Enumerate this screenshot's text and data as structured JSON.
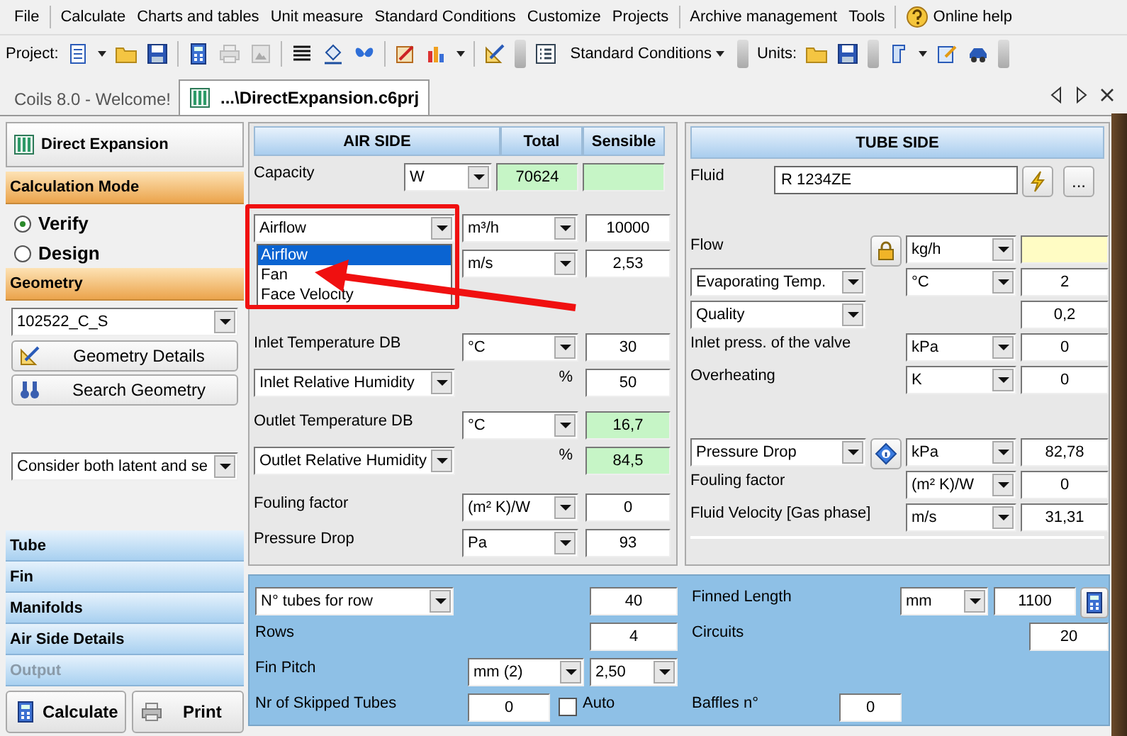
{
  "menu": [
    {
      "items": [
        {
          "label": "File",
          "kind": "text"
        }
      ]
    },
    {
      "items": [
        {
          "label": "Calculate",
          "kind": "text"
        },
        {
          "label": "Charts and tables",
          "kind": "text"
        },
        {
          "label": "Unit measure",
          "kind": "text"
        },
        {
          "label": "Standard Conditions",
          "kind": "text"
        },
        {
          "label": "Customize",
          "kind": "text"
        },
        {
          "label": "Projects",
          "kind": "text"
        }
      ]
    },
    {
      "items": [
        {
          "label": "Archive management",
          "kind": "text"
        },
        {
          "label": "Tools",
          "kind": "text"
        }
      ]
    },
    {
      "items": [
        {
          "label": "Online help",
          "kind": "help"
        }
      ]
    }
  ],
  "toolbar": {
    "project_label": "Project:",
    "conditions_button": "Standard Conditions",
    "units_label": "Units:"
  },
  "tabs": [
    {
      "label": "Coils 8.0 - Welcome!",
      "selected": false
    },
    {
      "label": "...\\DirectExpansion.c6prj",
      "selected": true
    }
  ],
  "sidebar": {
    "title": "Direct Expansion",
    "calculation_mode": {
      "title": "Calculation Mode",
      "options": [
        {
          "label": "Verify",
          "selected": true
        },
        {
          "label": "Design",
          "selected": false
        }
      ]
    },
    "geometry": {
      "title": "Geometry",
      "selected_geometry": "102522_C_S",
      "buttons": [
        "Geometry Details",
        "Search Geometry"
      ],
      "humidity_mode": "Consider both latent and se"
    },
    "nav_items": [
      {
        "label": "Tube",
        "disabled": false
      },
      {
        "label": "Fin",
        "disabled": false
      },
      {
        "label": "Manifolds",
        "disabled": false
      },
      {
        "label": "Air Side Details",
        "disabled": false
      },
      {
        "label": "Output",
        "disabled": true
      }
    ],
    "actions": [
      "Calculate",
      "Print"
    ]
  },
  "air_side": {
    "title": "AIR SIDE",
    "columns": [
      "Total",
      "Sensible"
    ],
    "groups": [
      [
        {
          "kind": "label",
          "label": "Capacity",
          "unit": {
            "kind": "select",
            "text": "W"
          },
          "values": [
            {
              "text": "70624",
              "computed": true
            },
            {
              "computed": true
            }
          ]
        }
      ],
      [
        {
          "kind": "select",
          "label": "Airflow",
          "unit": {
            "kind": "select",
            "text": "m³/h"
          },
          "values": [
            {
              "text": "10000",
              "computed": false
            }
          ]
        },
        {
          "kind": "none",
          "unit": {
            "kind": "select",
            "text": "m/s"
          },
          "values": [
            {
              "text": "2,53",
              "computed": false
            }
          ]
        }
      ],
      [
        {
          "kind": "label",
          "label": "Inlet Temperature DB",
          "unit": {
            "kind": "select",
            "text": "°C"
          },
          "values": [
            {
              "text": "30",
              "computed": false
            }
          ]
        },
        {
          "kind": "select",
          "label": "Inlet Relative Humidity",
          "unit": {
            "kind": "text",
            "text": "%"
          },
          "values": [
            {
              "text": "50",
              "computed": false
            }
          ]
        }
      ],
      [
        {
          "kind": "label",
          "label": "Outlet Temperature DB",
          "unit": {
            "kind": "select",
            "text": "°C"
          },
          "values": [
            {
              "text": "16,7",
              "computed": true
            }
          ]
        },
        {
          "kind": "select",
          "label": "Outlet Relative Humidity",
          "unit": {
            "kind": "text",
            "text": "%"
          },
          "values": [
            {
              "text": "84,5",
              "computed": true
            }
          ]
        }
      ],
      [
        {
          "kind": "label",
          "label": "Fouling factor",
          "unit": {
            "kind": "select",
            "text": "(m² K)/W"
          },
          "values": [
            {
              "text": "0",
              "computed": false
            }
          ]
        },
        {
          "kind": "label",
          "label": "Pressure Drop",
          "unit": {
            "kind": "select",
            "text": "Pa"
          },
          "values": [
            {
              "text": "93",
              "computed": false
            }
          ]
        }
      ]
    ],
    "airflow_dropdown": {
      "options": [
        {
          "label": "Airflow",
          "selected": true
        },
        {
          "label": "Fan",
          "selected": false
        },
        {
          "label": "Face Velocity",
          "selected": false
        }
      ]
    }
  },
  "tube_side": {
    "title": "TUBE SIDE",
    "fluid": {
      "label": "Fluid",
      "value": "R 1234ZE",
      "browse_button": "..."
    },
    "groups": [
      [
        {
          "kind": "label",
          "label": "Flow",
          "tool": {
            "kind": "lock"
          },
          "unit": {
            "kind": "select",
            "text": "kg/h"
          },
          "values": [
            {
              "computed": false,
              "required": true
            }
          ]
        },
        {
          "kind": "select",
          "label": "Evaporating Temp.",
          "unit": {
            "kind": "select",
            "text": "°C"
          },
          "values": [
            {
              "text": "2",
              "computed": false
            }
          ]
        },
        {
          "kind": "select",
          "label": "Quality",
          "values": [
            {
              "text": "0,2",
              "computed": false
            }
          ]
        },
        {
          "kind": "label",
          "label": "Inlet press. of the valve",
          "unit": {
            "kind": "select",
            "text": "kPa"
          },
          "values": [
            {
              "text": "0",
              "computed": false
            }
          ]
        },
        {
          "kind": "label",
          "label": "Overheating",
          "unit": {
            "kind": "select",
            "text": "K"
          },
          "values": [
            {
              "text": "0",
              "computed": false
            }
          ]
        }
      ],
      [
        {
          "kind": "select",
          "label": "Pressure Drop",
          "tool": {
            "kind": "info"
          },
          "unit": {
            "kind": "select",
            "text": "kPa"
          },
          "values": [
            {
              "text": "82,78",
              "computed": false
            }
          ]
        },
        {
          "kind": "label",
          "label": "Fouling factor",
          "unit": {
            "kind": "select",
            "text": "(m² K)/W"
          },
          "values": [
            {
              "text": "0",
              "computed": false
            }
          ]
        },
        {
          "kind": "label",
          "label": "Fluid Velocity [Gas phase]",
          "unit": {
            "kind": "select",
            "text": "m/s"
          },
          "values": [
            {
              "text": "31,31",
              "computed": false
            }
          ]
        }
      ]
    ]
  },
  "geometry_panel": {
    "rows": [
      {
        "left": {
          "kind": "select",
          "label": "N° tubes for row",
          "value": "40"
        },
        "right": {
          "kind": "unit",
          "label": "Finned Length",
          "unit": "mm",
          "value": "1100"
        }
      },
      {
        "left": {
          "kind": "label",
          "label": "Rows",
          "value": "4"
        },
        "right": {
          "kind": "value",
          "label": "Circuits",
          "value": "20"
        }
      },
      {
        "left": {
          "kind": "pitch",
          "label": "Fin Pitch",
          "unit": "mm (2)",
          "value": "2,50"
        }
      },
      {
        "left": {
          "kind": "skip",
          "label": "Nr of Skipped Tubes",
          "value": "0",
          "checkbox": {
            "label": "Auto",
            "checked": false
          }
        },
        "right": {
          "kind": "inline",
          "label": "Baffles n°",
          "value": "0"
        }
      }
    ]
  }
}
